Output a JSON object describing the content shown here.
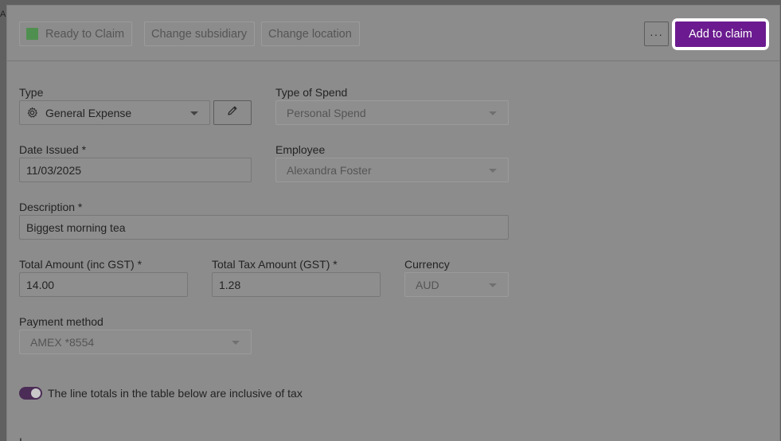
{
  "background_cut_text": "A",
  "toolbar": {
    "status_label": "Ready to Claim",
    "change_subsidiary_label": "Change subsidiary",
    "change_location_label": "Change location",
    "more_label": "···",
    "add_to_claim_label": "Add to claim"
  },
  "form": {
    "type": {
      "label": "Type",
      "value": "General Expense"
    },
    "type_of_spend": {
      "label": "Type of Spend",
      "value": "Personal Spend"
    },
    "date_issued": {
      "label": "Date Issued *",
      "value": "11/03/2025"
    },
    "employee": {
      "label": "Employee",
      "value": "Alexandra Foster"
    },
    "description": {
      "label": "Description *",
      "value": "Biggest morning tea"
    },
    "total_amount": {
      "label": "Total Amount (inc GST) *",
      "value": "14.00"
    },
    "total_tax": {
      "label": "Total Tax Amount (GST) *",
      "value": "1.28"
    },
    "currency": {
      "label": "Currency",
      "value": "AUD"
    },
    "payment_method": {
      "label": "Payment method",
      "value": "AMEX *8554"
    },
    "tax_inclusive_toggle": {
      "label": "The line totals in the table below are inclusive of tax",
      "on": true
    },
    "items_heading_cut": "I"
  },
  "colors": {
    "accent": "#6b1b8f",
    "status_swatch": "#4f8f4f",
    "toggle_on": "#4b2c56"
  }
}
